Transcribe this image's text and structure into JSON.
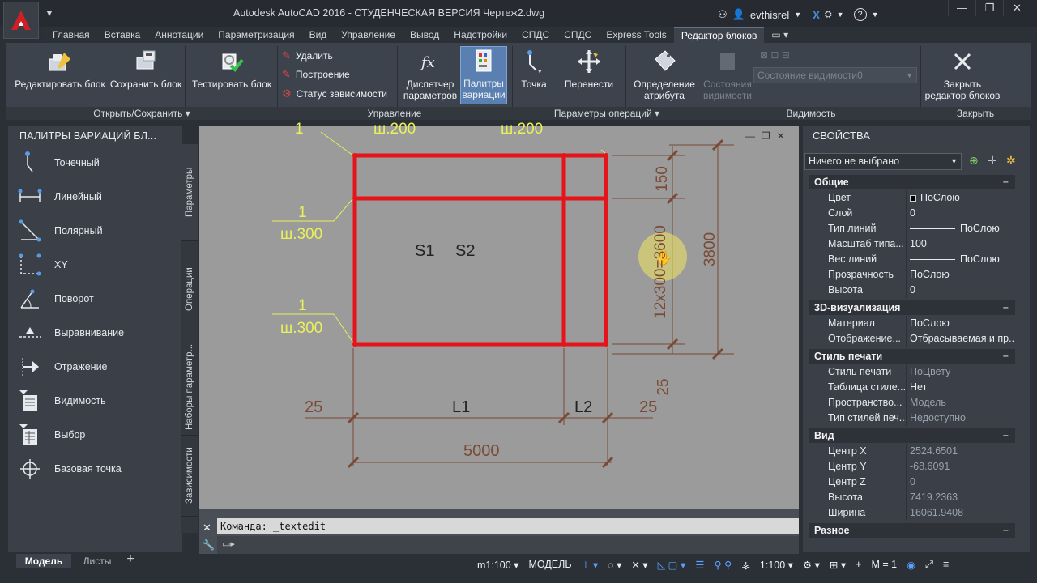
{
  "window": {
    "title": "Autodesk AutoCAD 2016 - СТУДЕНЧЕСКАЯ ВЕРСИЯ     Чертеж2.dwg",
    "user": "evthisrel",
    "help": "?"
  },
  "tabs": [
    "Главная",
    "Вставка",
    "Аннотации",
    "Параметризация",
    "Вид",
    "Управление",
    "Вывод",
    "Надстройки",
    "СПДС",
    "СПДС",
    "Express Tools",
    "Редактор блоков"
  ],
  "active_tab": "Редактор блоков",
  "ribbon": {
    "edit_block": "Редактировать блок",
    "save_block": "Сохранить блок",
    "test_block": "Тестировать блок",
    "delete": "Удалить",
    "build": "Построение",
    "dep_status": "Статус зависимости",
    "param_manager": "Диспетчер параметров",
    "palettes": "Палитры вариации",
    "point": "Точка",
    "move": "Перенести",
    "attr_def": "Определение атрибута",
    "vis_states": "Состояния видимости",
    "vis_state_dropdown": "Состояние видимости0",
    "close_editor": "Закрыть редактор блоков",
    "panels": {
      "open_save": "Открыть/Сохранить",
      "manage": "Управление",
      "op_params": "Параметры операций",
      "visibility": "Видимость",
      "close": "Закрыть"
    }
  },
  "left_palette": {
    "title": "ПАЛИТРЫ ВАРИАЦИЙ БЛ...",
    "items": [
      "Точечный",
      "Линейный",
      "Полярный",
      "XY",
      "Поворот",
      "Выравнивание",
      "Отражение",
      "Видимость",
      "Выбор",
      "Базовая точка"
    ],
    "side_tabs": [
      "Параметры",
      "Операции",
      "Наборы параметр...",
      "Зависимости"
    ]
  },
  "drawing": {
    "top_labels": [
      "ш.200",
      "ш.200"
    ],
    "left_labels": [
      {
        "num": "1",
        "val": "ш.300"
      },
      {
        "num": "1",
        "val": "ш.300"
      }
    ],
    "top_num": "1",
    "s_labels": [
      "S1",
      "S2"
    ],
    "dims_bottom": [
      "25",
      "L1",
      "L2",
      "25"
    ],
    "dim_total": "5000",
    "dims_right": [
      "150",
      "12x300=3600",
      "3800",
      "25"
    ]
  },
  "command": {
    "history": "Команда:  _textedit"
  },
  "properties": {
    "title": "СВОЙСТВА",
    "selection": "Ничего не выбрано",
    "sections": [
      {
        "name": "Общие",
        "rows": [
          [
            "Цвет",
            "ПоСлою"
          ],
          [
            "Слой",
            "0"
          ],
          [
            "Тип линий",
            "ПоСлою"
          ],
          [
            "Масштаб типа...",
            "100"
          ],
          [
            "Вес линий",
            "ПоСлою"
          ],
          [
            "Прозрачность",
            "ПоСлою"
          ],
          [
            "Высота",
            "0"
          ]
        ]
      },
      {
        "name": "3D-визуализация",
        "rows": [
          [
            "Материал",
            "ПоСлою"
          ],
          [
            "Отображение...",
            "Отбрасываемая и пр..."
          ]
        ]
      },
      {
        "name": "Стиль печати",
        "rows": [
          [
            "Стиль печати",
            "ПоЦвету"
          ],
          [
            "Таблица стиле...",
            "Нет"
          ],
          [
            "Пространство...",
            "Модель"
          ],
          [
            "Тип стилей печ...",
            "Недоступно"
          ]
        ]
      },
      {
        "name": "Вид",
        "rows": [
          [
            "Центр X",
            "2524.6501"
          ],
          [
            "Центр Y",
            "-68.6091"
          ],
          [
            "Центр Z",
            "0"
          ],
          [
            "Высота",
            "7419.2363"
          ],
          [
            "Ширина",
            "16061.9408"
          ]
        ]
      },
      {
        "name": "Разное",
        "rows": []
      }
    ]
  },
  "status": {
    "model_tab": "Модель",
    "layouts_tab": "Листы",
    "add_tab": "+",
    "scale_label": "m1:100",
    "space": "МОДЕЛЬ",
    "anno_scale": "1:100",
    "m_value": "M = 1"
  },
  "colors": {
    "block_red": "#e5141b",
    "yellow_text": "#e8f05a",
    "dim_brown": "#7a4a35",
    "ribbon_bg": "#3d434c",
    "selected_blue": "#5a7fb1"
  }
}
